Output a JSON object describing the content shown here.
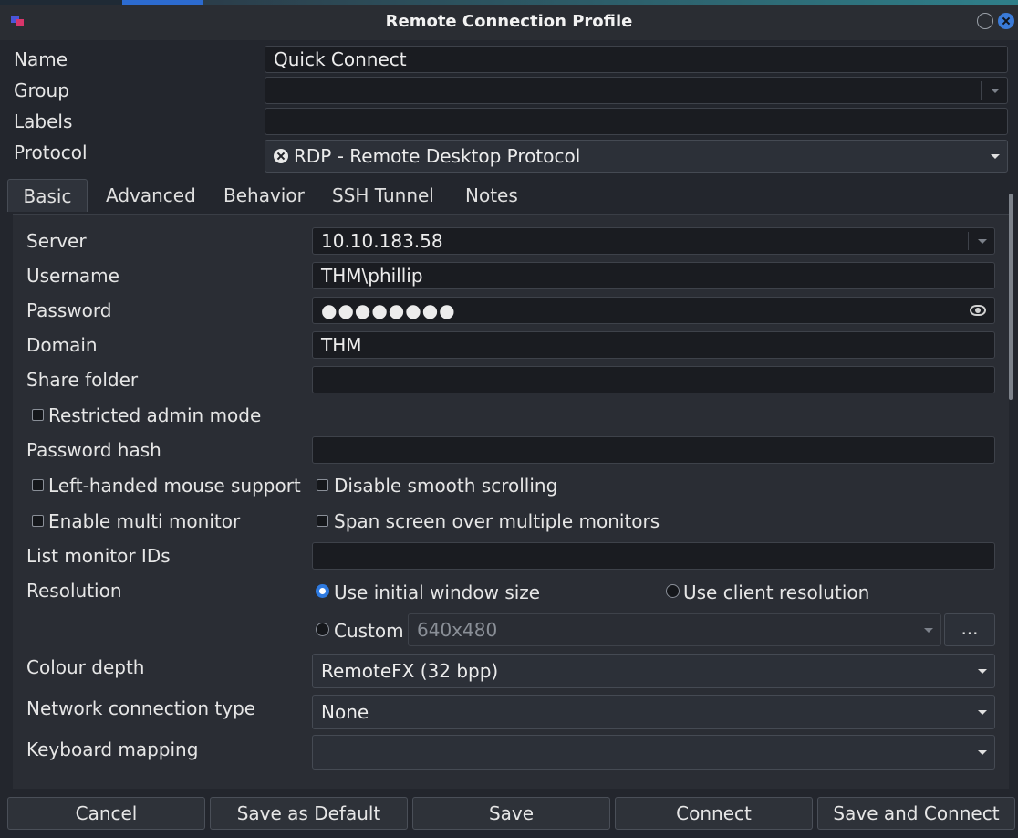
{
  "window": {
    "title": "Remote Connection Profile"
  },
  "profile": {
    "name_label": "Name",
    "name_value": "Quick Connect",
    "group_label": "Group",
    "group_value": "",
    "labels_label": "Labels",
    "labels_value": "",
    "protocol_label": "Protocol",
    "protocol_value": "RDP - Remote Desktop Protocol"
  },
  "tabs": [
    {
      "label": "Basic",
      "active": true
    },
    {
      "label": "Advanced",
      "active": false
    },
    {
      "label": "Behavior",
      "active": false
    },
    {
      "label": "SSH Tunnel",
      "active": false
    },
    {
      "label": "Notes",
      "active": false
    }
  ],
  "basic": {
    "server_label": "Server",
    "server_value": "10.10.183.58",
    "username_label": "Username",
    "username_value": "THM\\phillip",
    "password_label": "Password",
    "password_value": "●●●●●●●●",
    "domain_label": "Domain",
    "domain_value": "THM",
    "share_label": "Share folder",
    "share_value": "",
    "restricted_admin": {
      "label": "Restricted admin mode",
      "checked": false
    },
    "pwhash_label": "Password hash",
    "pwhash_value": "",
    "left_handed": {
      "label": "Left-handed mouse support",
      "checked": false
    },
    "disable_smooth": {
      "label": "Disable smooth scrolling",
      "checked": false
    },
    "multi_monitor": {
      "label": "Enable multi monitor",
      "checked": false
    },
    "span_screen": {
      "label": "Span screen over multiple monitors",
      "checked": false
    },
    "monitor_ids_label": "List monitor IDs",
    "monitor_ids_value": "",
    "resolution_label": "Resolution",
    "res_initial": "Use initial window size",
    "res_client": "Use client resolution",
    "res_custom": "Custom",
    "res_custom_value": "640x480",
    "res_selected": "initial",
    "res_more_label": "...",
    "colour_label": "Colour depth",
    "colour_value": "RemoteFX (32 bpp)",
    "network_label": "Network connection type",
    "network_value": "None",
    "keyboard_label": "Keyboard mapping",
    "keyboard_value": ""
  },
  "buttons": {
    "cancel": "Cancel",
    "save_default": "Save as Default",
    "save": "Save",
    "connect": "Connect",
    "save_connect": "Save and Connect"
  },
  "colors": {
    "accent": "#2e7ae0",
    "background": "#23262d",
    "field": "#1a1c21"
  }
}
